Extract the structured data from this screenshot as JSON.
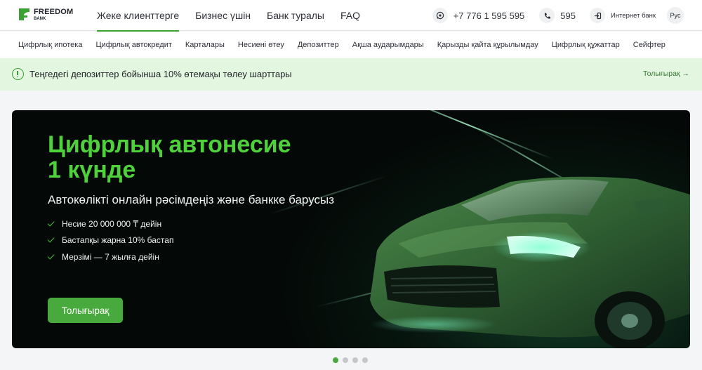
{
  "brand": {
    "line1": "FREEDOM",
    "line2": "BANK",
    "logo_color": "#3ca133"
  },
  "topnav": {
    "items": [
      {
        "label": "Жеке клиенттерге",
        "active": true
      },
      {
        "label": "Бизнес үшін",
        "active": false
      },
      {
        "label": "Банк туралы",
        "active": false
      },
      {
        "label": "FAQ",
        "active": false
      }
    ]
  },
  "header_right": {
    "phone": "+7 776 1 595 595",
    "short_number": "595",
    "internet_bank": "Интернет банк",
    "language": "Рус",
    "icons": [
      "whatsapp-icon",
      "phone-icon",
      "login-icon"
    ]
  },
  "subnav": {
    "items": [
      "Цифрлық ипотека",
      "Цифрлық автокредит",
      "Карталары",
      "Несиені өтеу",
      "Депозиттер",
      "Ақша аударымдары",
      "Қарызды қайта құрылымдау",
      "Цифрлық құжаттар",
      "Сейфтер"
    ]
  },
  "notice": {
    "text": "Теңгедегі депозиттер бойынша 10% өтемақы төлеу шарттары",
    "link": "Толығырақ →",
    "color": "#e3f6e0"
  },
  "banner": {
    "title_line1": "Цифрлық автонесие",
    "title_line2": "1 күнде",
    "subtitle": "Автокөлікті онлайн рәсімдеңіз және банкке барусыз",
    "bullets": [
      "Несие 20 000 000 ₸ дейін",
      "Бастапқы жарна 10% бастап",
      "Мерзімі — 7 жылға дейін"
    ],
    "button": "Толығырақ",
    "accent": "#4fd13c",
    "image": "green-suv-car-image"
  },
  "carousel": {
    "count": 4,
    "active_index": 0
  }
}
